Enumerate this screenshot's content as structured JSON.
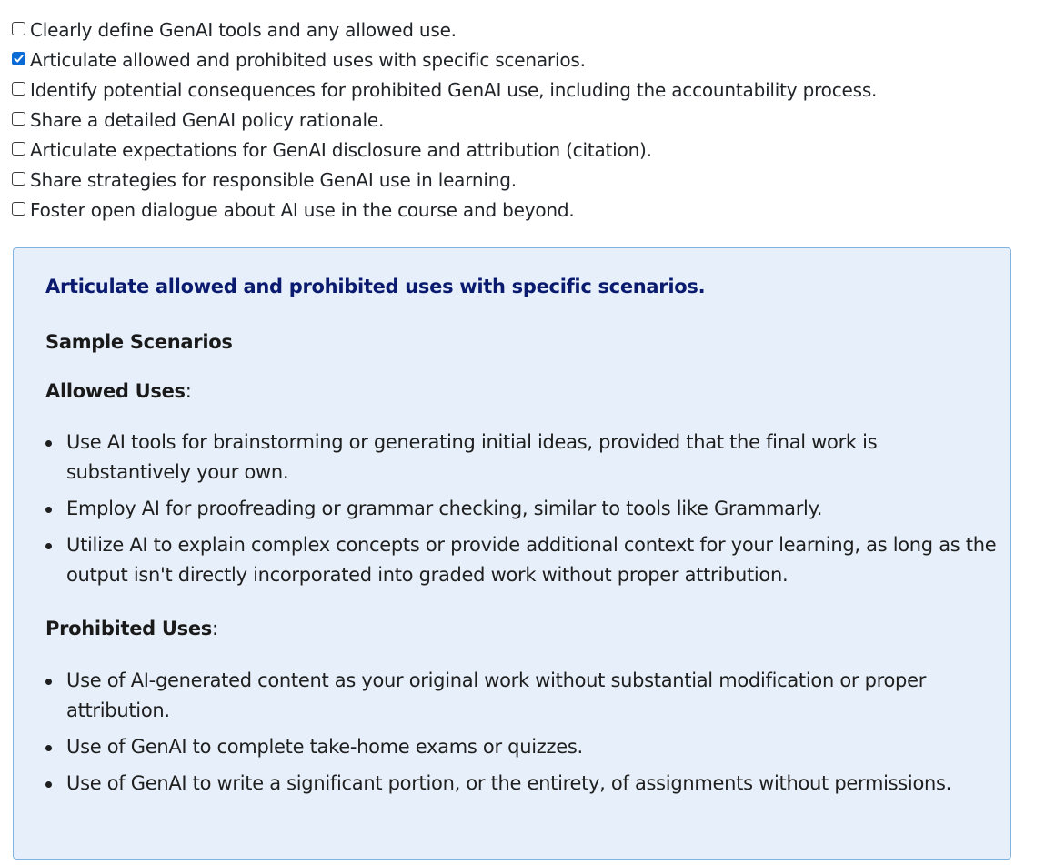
{
  "checklist": [
    {
      "label": "Clearly define GenAI tools and any allowed use.",
      "checked": false
    },
    {
      "label": "Articulate allowed and prohibited uses with specific scenarios.",
      "checked": true
    },
    {
      "label": "Identify potential consequences for prohibited GenAI use, including the accountability process.",
      "checked": false
    },
    {
      "label": "Share a detailed GenAI policy rationale.",
      "checked": false
    },
    {
      "label": "Articulate expectations for GenAI disclosure and attribution (citation).",
      "checked": false
    },
    {
      "label": "Share strategies for responsible GenAI use in learning.",
      "checked": false
    },
    {
      "label": "Foster open dialogue about AI use in the course and beyond.",
      "checked": false
    }
  ],
  "panel": {
    "title": "Articulate allowed and prohibited uses with specific scenarios.",
    "sample_heading": "Sample Scenarios",
    "allowed": {
      "heading": "Allowed Uses",
      "colon": ":",
      "items": [
        "Use AI tools for brainstorming or generating initial ideas, provided that the final work is substantively your own.",
        "Employ AI for proofreading or grammar checking, similar to tools like Grammarly.",
        "Utilize AI to explain complex concepts or provide additional context for your learning, as long as the output isn't directly incorporated into graded work without proper attribution."
      ]
    },
    "prohibited": {
      "heading": "Prohibited Uses",
      "colon": ":",
      "items": [
        "Use of AI-generated content as your original work without substantial modification or proper attribution.",
        "Use of GenAI to complete take-home exams or quizzes.",
        "Use of GenAI to write a significant portion, or the entirety, of assignments without permissions."
      ]
    }
  },
  "colors": {
    "accent": "#0b6bd6",
    "panel_bg": "#e7f0fa",
    "panel_border": "#7fb4e0",
    "title": "#0a1a6e"
  }
}
